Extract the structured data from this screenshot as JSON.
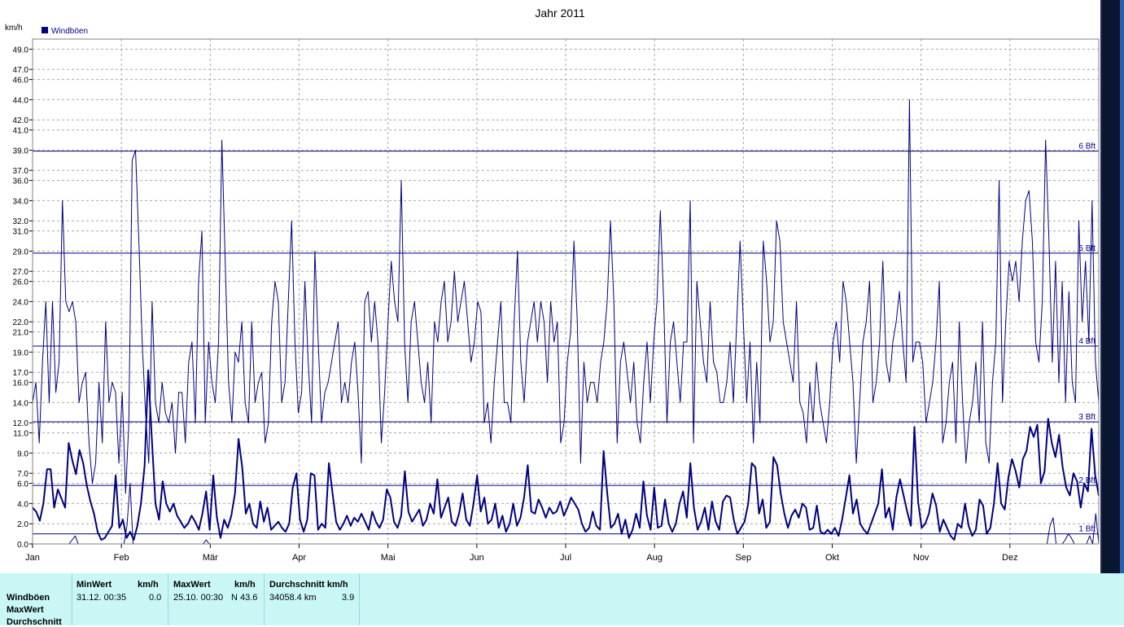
{
  "chart_data": {
    "type": "line",
    "title": "Jahr 2011",
    "ylabel": "km/h",
    "legend": [
      {
        "name": "Windböen",
        "color": "#000080"
      }
    ],
    "ylim": [
      0,
      50
    ],
    "y_ticks": [
      "0.0",
      "2.0",
      "4.0",
      "6.0",
      "7.0",
      "9.0",
      "11.0",
      "12.0",
      "14.0",
      "16.0",
      "17.0",
      "19.0",
      "21.0",
      "22.0",
      "24.0",
      "26.0",
      "27.0",
      "29.0",
      "31.0",
      "32.0",
      "34.0",
      "36.0",
      "37.0",
      "39.0",
      "41.0",
      "42.0",
      "44.0",
      "46.0",
      "47.0",
      "49.0"
    ],
    "x_ticks": [
      "Jan",
      "Feb",
      "Mär",
      "Apr",
      "Mai",
      "Jun",
      "Jul",
      "Aug",
      "Sep",
      "Okt",
      "Nov",
      "Dez"
    ],
    "beaufort_lines": [
      {
        "label": "1 Bft",
        "value": 1.0
      },
      {
        "label": "2 Bft",
        "value": 5.8
      },
      {
        "label": "3 Bft",
        "value": 12.1
      },
      {
        "label": "4 Bft",
        "value": 19.6
      },
      {
        "label": "5 Bft",
        "value": 28.8
      },
      {
        "label": "6 Bft",
        "value": 38.9
      }
    ],
    "series": [
      {
        "name": "Windböen (Max)",
        "x_range": [
          "01.01.",
          "31.12."
        ],
        "values": [
          14,
          16,
          10,
          18,
          24,
          14,
          24,
          15,
          18,
          34,
          24,
          23,
          24,
          22,
          14,
          16,
          17,
          10,
          6,
          8,
          16,
          10,
          22,
          14,
          16,
          15,
          8,
          15,
          5,
          12,
          38,
          39,
          30,
          20,
          13,
          8,
          24,
          14,
          12,
          16,
          13,
          12,
          14,
          9,
          15,
          15,
          10,
          18,
          20,
          12,
          26,
          31,
          12,
          20,
          16,
          14,
          20,
          40,
          28,
          16,
          12,
          19,
          18,
          22,
          14,
          12,
          22,
          14,
          16,
          17,
          10,
          12,
          22,
          26,
          24,
          14,
          16,
          24,
          32,
          20,
          13,
          15,
          26,
          18,
          12,
          29,
          20,
          12,
          15,
          16,
          18,
          20,
          22,
          14,
          16,
          14,
          18,
          20,
          15,
          8,
          24,
          25,
          20,
          24,
          20,
          10,
          15,
          22,
          28,
          24,
          22,
          36,
          20,
          14,
          22,
          24,
          20,
          16,
          14,
          18,
          12,
          22,
          20,
          24,
          26,
          20,
          22,
          27,
          22,
          24,
          26,
          22,
          18,
          20,
          24,
          23,
          12,
          14,
          10,
          16,
          20,
          24,
          14,
          14,
          12,
          22,
          29,
          18,
          14,
          20,
          22,
          24,
          20,
          24,
          22,
          16,
          24,
          20,
          22,
          10,
          12,
          18,
          21,
          30,
          22,
          8,
          18,
          14,
          16,
          16,
          14,
          18,
          20,
          24,
          32,
          24,
          10,
          18,
          20,
          17,
          14,
          18,
          12,
          10,
          16,
          20,
          14,
          20,
          24,
          33,
          24,
          12,
          20,
          22,
          18,
          14,
          20,
          20,
          34,
          10,
          26,
          22,
          18,
          16,
          24,
          18,
          17,
          14,
          14,
          16,
          20,
          14,
          22,
          30,
          22,
          14,
          20,
          10,
          18,
          12,
          30,
          26,
          20,
          22,
          32,
          30,
          22,
          20,
          18,
          16,
          24,
          14,
          13,
          10,
          16,
          12,
          18,
          14,
          12,
          10,
          14,
          20,
          22,
          18,
          26,
          24,
          20,
          16,
          8,
          14,
          20,
          22,
          26,
          14,
          16,
          20,
          28,
          18,
          16,
          20,
          22,
          25,
          20,
          16,
          44,
          18,
          20,
          20,
          18,
          12,
          14,
          16,
          20,
          26,
          10,
          12,
          16,
          18,
          10,
          22,
          14,
          8,
          12,
          14,
          18,
          12,
          22,
          10,
          8,
          16,
          20,
          36,
          14,
          22,
          28,
          26,
          28,
          24,
          30,
          34,
          35,
          30,
          20,
          18,
          24,
          40,
          30,
          18,
          28,
          16,
          26,
          14,
          25,
          16,
          14,
          32,
          22,
          28,
          20,
          34,
          18,
          14
        ]
      },
      {
        "name": "Windböen (Durchschnitt)",
        "x_range": [
          "01.01.",
          "31.12."
        ],
        "values": [
          3.6,
          3.2,
          2.3,
          4.0,
          7.4,
          7.4,
          3.6,
          5.4,
          4.5,
          3.6,
          10.0,
          8.3,
          6.9,
          9.3,
          8.0,
          5.8,
          4.2,
          3.0,
          1.2,
          0.4,
          0.6,
          1.2,
          1.8,
          6.8,
          1.6,
          2.4,
          0.6,
          1.2,
          0.4,
          1.8,
          4.0,
          7.8,
          17.2,
          10.5,
          4.0,
          2.4,
          6.2,
          4.0,
          3.2,
          4.0,
          2.8,
          2.2,
          1.6,
          2.0,
          2.8,
          2.2,
          1.4,
          3.0,
          5.2,
          1.4,
          6.8,
          2.6,
          0.6,
          2.4,
          1.6,
          2.8,
          5.0,
          10.4,
          7.6,
          3.0,
          4.0,
          2.0,
          1.6,
          4.2,
          2.2,
          3.6,
          1.4,
          1.8,
          2.2,
          1.6,
          1.2,
          2.0,
          5.6,
          7.0,
          2.4,
          1.2,
          2.4,
          7.0,
          6.8,
          1.4,
          2.0,
          1.6,
          8.0,
          5.0,
          2.2,
          1.4,
          2.0,
          2.8,
          1.8,
          2.6,
          2.2,
          3.0,
          2.2,
          1.4,
          3.2,
          2.2,
          1.6,
          2.4,
          5.4,
          4.6,
          2.2,
          1.6,
          2.8,
          7.2,
          3.2,
          2.2,
          2.8,
          3.4,
          1.8,
          2.4,
          4.0,
          3.0,
          6.4,
          2.6,
          3.6,
          4.6,
          2.2,
          1.8,
          3.0,
          5.0,
          2.4,
          1.8,
          4.0,
          6.8,
          3.2,
          4.6,
          2.0,
          2.4,
          4.0,
          1.6,
          2.8,
          1.2,
          2.0,
          4.0,
          1.8,
          2.6,
          4.6,
          7.8,
          3.2,
          3.0,
          4.4,
          3.6,
          2.6,
          3.6,
          3.0,
          3.2,
          4.2,
          2.8,
          3.6,
          4.6,
          4.0,
          3.4,
          2.0,
          1.2,
          1.6,
          3.2,
          1.8,
          1.4,
          9.2,
          5.0,
          1.6,
          2.0,
          3.0,
          1.0,
          2.4,
          0.6,
          1.4,
          3.0,
          1.6,
          6.2,
          2.8,
          1.4,
          5.6,
          1.6,
          1.8,
          4.4,
          2.0,
          1.2,
          2.0,
          4.0,
          5.2,
          2.6,
          8.0,
          3.6,
          1.4,
          2.2,
          3.6,
          1.4,
          4.2,
          2.2,
          1.4,
          4.2,
          4.8,
          4.6,
          2.4,
          1.0,
          1.6,
          2.2,
          4.0,
          8.0,
          7.6,
          3.0,
          4.4,
          1.6,
          2.2,
          8.6,
          7.8,
          5.0,
          3.0,
          1.6,
          2.8,
          3.4,
          2.6,
          4.0,
          3.6,
          1.4,
          1.6,
          3.8,
          1.2,
          1.0,
          1.4,
          1.0,
          1.6,
          0.8,
          2.4,
          4.6,
          6.8,
          3.0,
          4.4,
          2.0,
          1.4,
          1.0,
          2.0,
          3.0,
          4.0,
          7.4,
          2.6,
          3.6,
          1.4,
          4.6,
          6.4,
          4.8,
          3.2,
          1.8,
          11.6,
          4.2,
          1.6,
          2.0,
          3.0,
          5.0,
          3.8,
          1.2,
          2.4,
          1.6,
          0.8,
          0.4,
          2.0,
          1.6,
          4.0,
          1.8,
          0.8,
          1.4,
          4.4,
          3.8,
          1.0,
          1.6,
          4.0,
          8.0,
          4.0,
          3.4,
          6.6,
          8.4,
          7.2,
          5.6,
          8.4,
          9.2,
          11.6,
          10.6,
          11.8,
          6.0,
          7.2,
          12.4,
          10.0,
          8.6,
          10.8,
          7.6,
          5.6,
          4.8,
          7.0,
          6.2,
          3.6,
          6.0,
          5.2,
          11.4,
          6.8,
          4.8
        ]
      },
      {
        "name": "Windböen (Min)",
        "x_range": [
          "01.01.",
          "31.12."
        ],
        "values": [
          0,
          0,
          0,
          0,
          0,
          0,
          0,
          0,
          0,
          0,
          0,
          0,
          0,
          0.4,
          0.8,
          0,
          0,
          0,
          0,
          0,
          0,
          0,
          0,
          0,
          0,
          0,
          0,
          0,
          0,
          0,
          0,
          1.8,
          6.0,
          0,
          0,
          0,
          0,
          0,
          0,
          0,
          0,
          0,
          0,
          0,
          0,
          0,
          0,
          0,
          0,
          0,
          0,
          0,
          0,
          0,
          0,
          0,
          0,
          0.4,
          0,
          0,
          0,
          0,
          0,
          0,
          0,
          0,
          0,
          0,
          0,
          0,
          0,
          0,
          0,
          0,
          0,
          0,
          0,
          0,
          0,
          0,
          0,
          0,
          0,
          0,
          0,
          0,
          0,
          0,
          0,
          0,
          0,
          0,
          0,
          0,
          0,
          0,
          0,
          0,
          0,
          0,
          0,
          0,
          0,
          0,
          0,
          0,
          0,
          0,
          0,
          0,
          0,
          0,
          0,
          0,
          0,
          0,
          0,
          0,
          0,
          0,
          0,
          0,
          0,
          0,
          0,
          0,
          0,
          0,
          0,
          0,
          0,
          0,
          0,
          0,
          0,
          0,
          0,
          0,
          0,
          0,
          0,
          0,
          0,
          0,
          0,
          0,
          0,
          0,
          0,
          0,
          0,
          0,
          0,
          0,
          0,
          0,
          0,
          0,
          0,
          0,
          0,
          0,
          0,
          0,
          0,
          0,
          0,
          0,
          0,
          0,
          0,
          0,
          0,
          0,
          0,
          0,
          0,
          0,
          0,
          0,
          0,
          0,
          0,
          0,
          0,
          0,
          0,
          0,
          0,
          0,
          0,
          0,
          0,
          0,
          0,
          0,
          0,
          0,
          0,
          0,
          0,
          0,
          0,
          0,
          0,
          0,
          0,
          0,
          0,
          0,
          0,
          0,
          0,
          0,
          0,
          0,
          0,
          0,
          0,
          0,
          0,
          0,
          0,
          0,
          0,
          0,
          0,
          0,
          0,
          0,
          0,
          0,
          0,
          0,
          0,
          0,
          0,
          0,
          0,
          0,
          0,
          0,
          0,
          0,
          0,
          0,
          0,
          0,
          0,
          0,
          0,
          0,
          0,
          0,
          0,
          0,
          0,
          0,
          0,
          0,
          0,
          0,
          0,
          0,
          0,
          0,
          0,
          0,
          0,
          0,
          0,
          0,
          0,
          0,
          0,
          0,
          0,
          0,
          0,
          0,
          0,
          0,
          0,
          0,
          0,
          0,
          0,
          0,
          0,
          0,
          0,
          0,
          0,
          0,
          0,
          0,
          0,
          0,
          0,
          0,
          0,
          0,
          0,
          0,
          0,
          0,
          0,
          0,
          0,
          0,
          0,
          0,
          0,
          0,
          0,
          0,
          0,
          0,
          0,
          0,
          0,
          0,
          0,
          0,
          0,
          0,
          0,
          0,
          0,
          0,
          0,
          0,
          0,
          0,
          1.8,
          2.6,
          0,
          0,
          0,
          0.4,
          1.0,
          0.6,
          0,
          0,
          0,
          0,
          0,
          0.8,
          0,
          3.0,
          0
        ]
      }
    ]
  },
  "stats": {
    "row_labels": [
      "Windböen",
      "MaxWert",
      "Durchschnitt"
    ],
    "min_header": "MinWert",
    "min_unit": "km/h",
    "min_time": "31.12.  00:35",
    "min_value": "0.0",
    "max_header": "MaxWert",
    "max_unit": "km/h",
    "max_time": "25.10.  00:30",
    "max_value": "N 43.6",
    "avg_header": "Durchschnitt km/h",
    "avg_distance": "34058.4 km",
    "avg_value": "3.9"
  },
  "colors": {
    "series": "#000080",
    "grid": "#a0a0a0",
    "stats_bg": "#c9f7f6"
  }
}
